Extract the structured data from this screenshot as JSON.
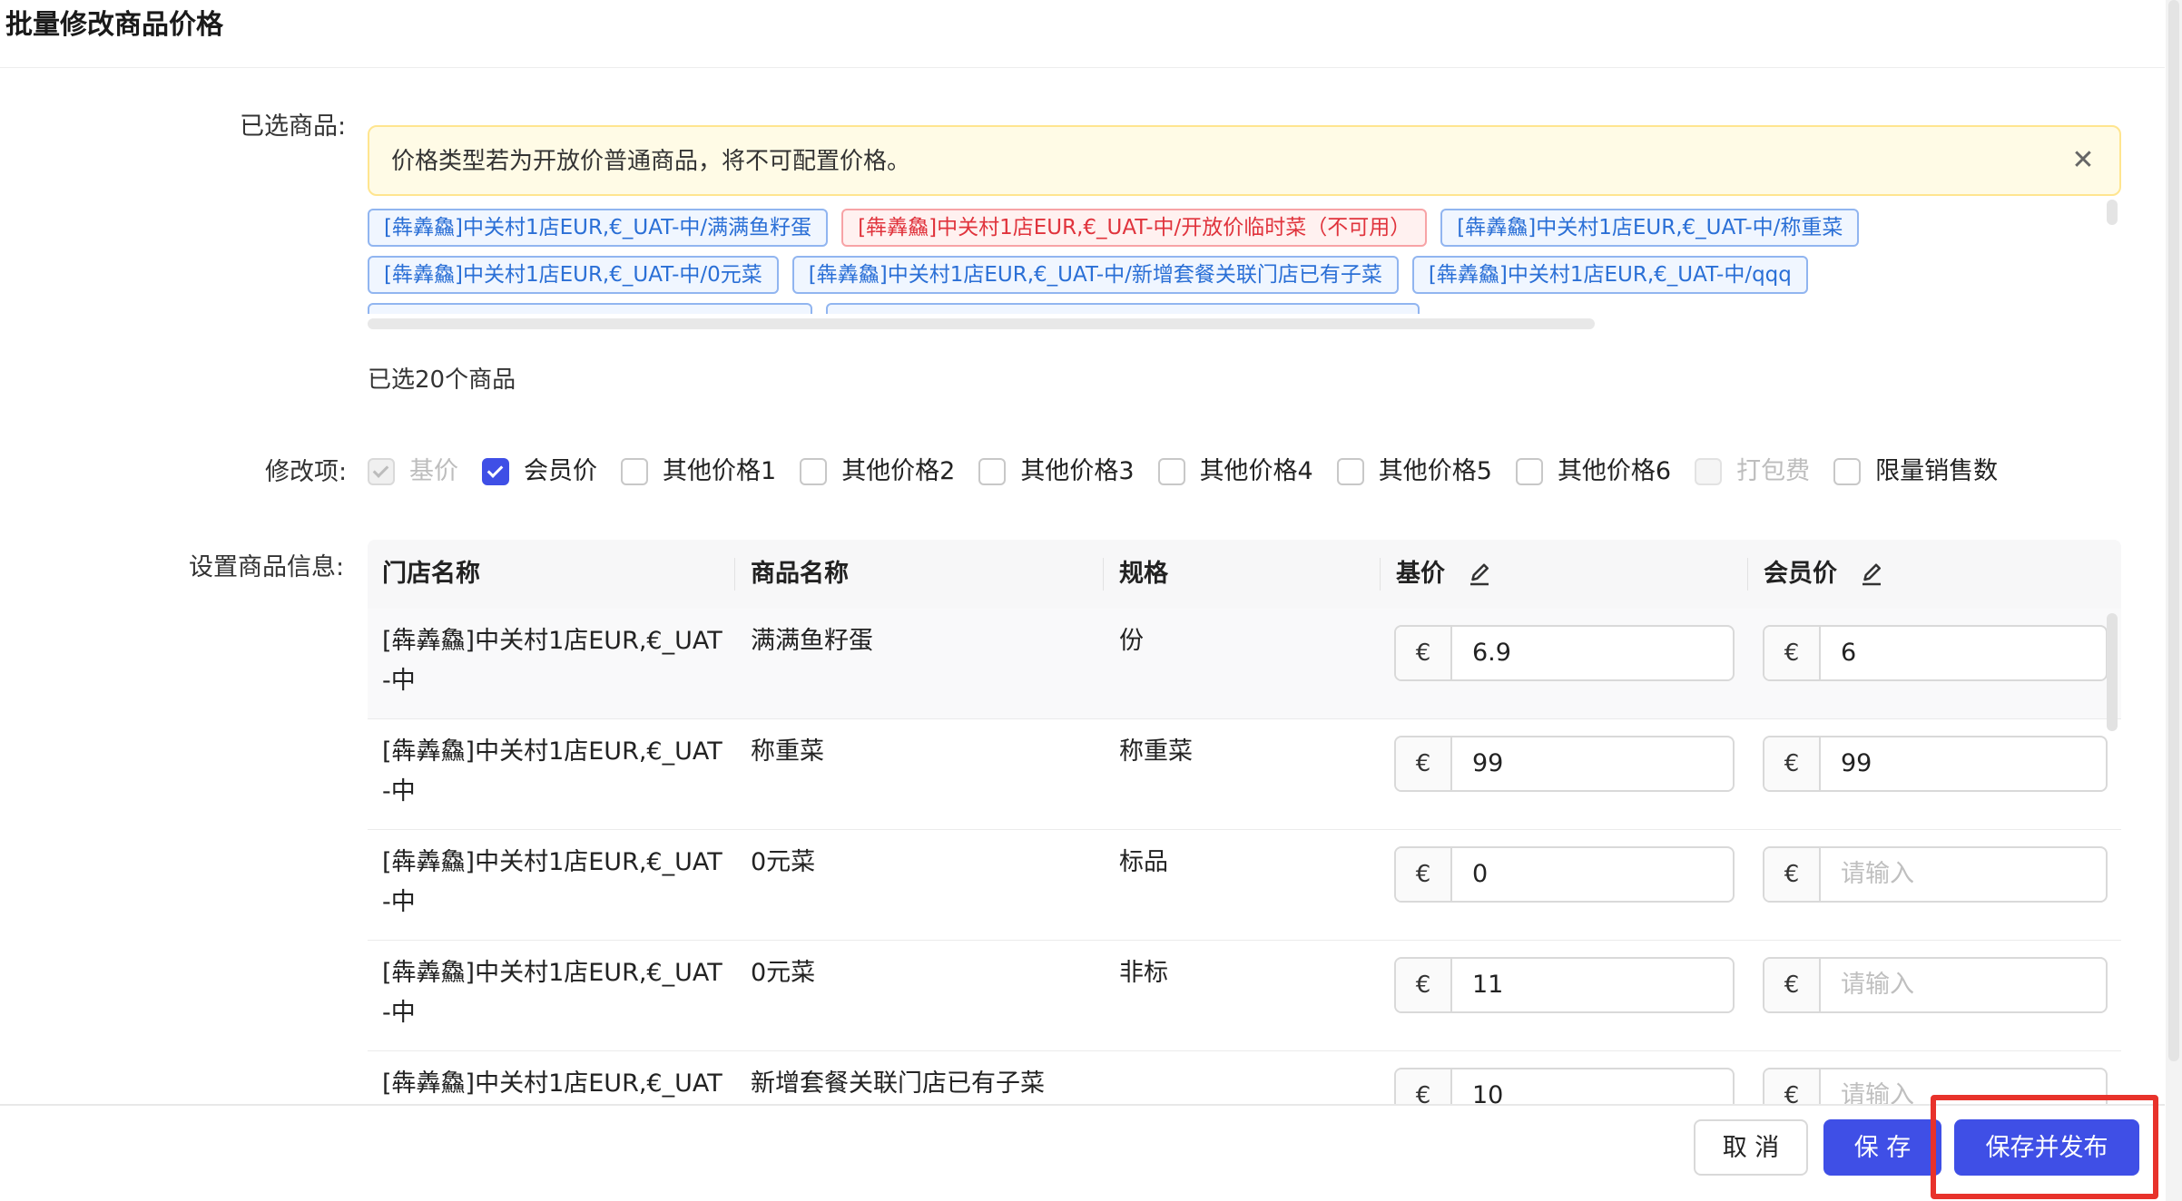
{
  "dialog": {
    "title": "批量修改商品价格"
  },
  "form": {
    "selected_label": "已选商品:",
    "edit_items_label": "修改项:",
    "set_info_label": "设置商品信息:"
  },
  "alert": {
    "text": "价格类型若为开放价普通商品，将不可配置价格。"
  },
  "tags": {
    "row1": [
      {
        "text": "[犇羴鱻]中关村1店EUR,€_UAT-中/满满鱼籽蛋",
        "status": "normal"
      },
      {
        "text": "[犇羴鱻]中关村1店EUR,€_UAT-中/开放价临时菜（不可用）",
        "status": "disabled"
      },
      {
        "text": "[犇羴鱻]中关村1店EUR,€_UAT-中/称重菜",
        "status": "normal"
      }
    ],
    "row2": [
      {
        "text": "[犇羴鱻]中关村1店EUR,€_UAT-中/0元菜",
        "status": "normal"
      },
      {
        "text": "[犇羴鱻]中关村1店EUR,€_UAT-中/新增套餐关联门店已有子菜",
        "status": "normal"
      },
      {
        "text": "[犇羴鱻]中关村1店EUR,€_UAT-中/qqq",
        "status": "normal"
      }
    ]
  },
  "selected_count_text": "已选20个商品",
  "edit_options": [
    {
      "label": "基价",
      "state": "disabled-checked"
    },
    {
      "label": "会员价",
      "state": "checked"
    },
    {
      "label": "其他价格1",
      "state": "unchecked"
    },
    {
      "label": "其他价格2",
      "state": "unchecked"
    },
    {
      "label": "其他价格3",
      "state": "unchecked"
    },
    {
      "label": "其他价格4",
      "state": "unchecked"
    },
    {
      "label": "其他价格5",
      "state": "unchecked"
    },
    {
      "label": "其他价格6",
      "state": "unchecked"
    },
    {
      "label": "打包费",
      "state": "disabled"
    },
    {
      "label": "限量销售数",
      "state": "unchecked"
    }
  ],
  "table": {
    "columns": {
      "store": "门店名称",
      "product": "商品名称",
      "spec": "规格",
      "base_price": "基价",
      "member_price": "会员价"
    },
    "currency_symbol": "€",
    "input_placeholder": "请输入",
    "rows": [
      {
        "store": "[犇羴鱻]中关村1店EUR,€_UAT-中",
        "product": "满满鱼籽蛋",
        "spec": "份",
        "base_price": "6.9",
        "member_price": "6"
      },
      {
        "store": "[犇羴鱻]中关村1店EUR,€_UAT-中",
        "product": "称重菜",
        "spec": "称重菜",
        "base_price": "99",
        "member_price": "99"
      },
      {
        "store": "[犇羴鱻]中关村1店EUR,€_UAT-中",
        "product": "0元菜",
        "spec": "标品",
        "base_price": "0",
        "member_price": ""
      },
      {
        "store": "[犇羴鱻]中关村1店EUR,€_UAT-中",
        "product": "0元菜",
        "spec": "非标",
        "base_price": "11",
        "member_price": ""
      },
      {
        "store": "[犇羴鱻]中关村1店EUR,€_UAT-中",
        "product": "新增套餐关联门店已有子菜",
        "spec": "",
        "base_price": "10",
        "member_price": ""
      }
    ]
  },
  "footer": {
    "cancel_label": "取 消",
    "save_label": "保 存",
    "publish_label": "保存并发布"
  },
  "colors": {
    "primary": "#3f4fe6",
    "highlight": "#e8322b",
    "alert_bg": "#fffbe6",
    "tag_blue": "#2a6fd6",
    "tag_red": "#e0333c"
  },
  "icons": {
    "alert_close": "close-icon",
    "column_edit": "edit-pencil-icon",
    "checkbox_check": "check-icon"
  }
}
